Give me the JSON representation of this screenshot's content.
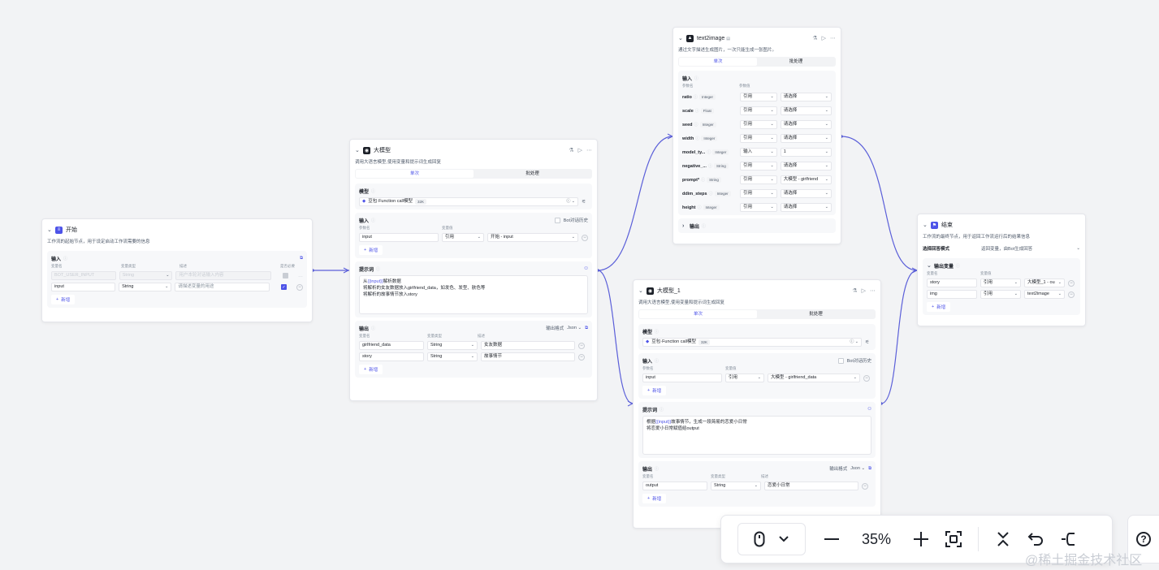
{
  "start": {
    "title": "开始",
    "desc": "工作流的起始节点，用于设定启动工作流需要的信息",
    "input_label": "输入",
    "col_name": "变量名",
    "col_type": "变量类型",
    "col_desc": "描述",
    "col_required": "是否必要",
    "rows": [
      {
        "name": "BOT_USER_INPUT",
        "type": "String",
        "desc": "用户本轮对话输入内容"
      },
      {
        "name": "input",
        "type": "String",
        "desc": "请描述变量的用途"
      }
    ],
    "add": "新增"
  },
  "llm": {
    "title": "大模型",
    "desc": "调用大语言模型,使用变量和提示词生成回复",
    "tab_single": "单次",
    "tab_batch": "批处理",
    "model_label": "模型",
    "model_name": "豆包·Function call模型",
    "model_ctx": "32K",
    "input_label": "输入",
    "bot_history": "Bot对话历史",
    "col_param": "参数名",
    "col_value": "变量值",
    "input_row": {
      "name": "input",
      "mode": "引用",
      "value": "开始 - input"
    },
    "add": "新增",
    "prompt_label": "提示词",
    "prompt_line1_var": "{{input}}",
    "prompt_line1_pre": "从",
    "prompt_line1_post": "解析数据",
    "prompt_line2": "将解析的女友数据放入girlfriend_data，如发色、发型、肤色等",
    "prompt_line3": "将解析的故事情节放入story",
    "output_label": "输出",
    "output_format_label": "输出格式",
    "output_format": "Json",
    "col_out_name": "变量名",
    "col_out_type": "变量类型",
    "col_out_desc": "描述",
    "outputs": [
      {
        "name": "girlfriend_data",
        "type": "String",
        "desc": "女友数据"
      },
      {
        "name": "story",
        "type": "String",
        "desc": "故事情节"
      }
    ]
  },
  "t2i": {
    "title": "text2image",
    "desc": "通过文字描述生成图片，一次只能生成一张图片。",
    "tab_single": "单次",
    "tab_batch": "批处理",
    "input_label": "输入",
    "col_param": "参数名",
    "col_value": "参数值",
    "params": [
      {
        "name": "ratio",
        "type": "Integer",
        "mode": "引用",
        "value": "请选择"
      },
      {
        "name": "scale",
        "type": "Float",
        "mode": "引用",
        "value": "请选择"
      },
      {
        "name": "seed",
        "type": "Integer",
        "mode": "引用",
        "value": "请选择"
      },
      {
        "name": "width",
        "type": "Integer",
        "mode": "引用",
        "value": "请选择"
      },
      {
        "name": "model_ty...",
        "type": "Integer",
        "mode": "输入",
        "value": "1"
      },
      {
        "name": "negative_...",
        "type": "String",
        "mode": "引用",
        "value": "请选择"
      },
      {
        "name": "prompt*",
        "type": "String",
        "mode": "引用",
        "value": "大模型 - girlfriend"
      },
      {
        "name": "ddim_steps",
        "type": "Integer",
        "mode": "引用",
        "value": "请选择"
      },
      {
        "name": "height",
        "type": "Integer",
        "mode": "引用",
        "value": "请选择"
      }
    ],
    "output_label": "输出"
  },
  "llm1": {
    "title": "大模型_1",
    "desc": "调用大语言模型,使用变量和提示词生成回复",
    "tab_single": "单次",
    "tab_batch": "批处理",
    "model_label": "模型",
    "model_name": "豆包·Function call模型",
    "model_ctx": "32K",
    "input_label": "输入",
    "bot_history": "Bot对话历史",
    "col_param": "参数名",
    "col_value": "变量值",
    "input_row": {
      "name": "input",
      "mode": "引用",
      "value": "大模型 - girlfriend_data"
    },
    "add": "新增",
    "prompt_label": "提示词",
    "prompt_line1_pre": "根据",
    "prompt_line1_var": "{{input}}",
    "prompt_line1_post": "故事情节，生成一段简易的恋爱小日常",
    "prompt_line2": "将恋爱小日常赋值给output",
    "output_label": "输出",
    "output_format_label": "输出格式",
    "output_format": "Json",
    "col_out_name": "变量名",
    "col_out_type": "变量类型",
    "col_out_desc": "描述",
    "outputs": [
      {
        "name": "output",
        "type": "String",
        "desc": "恋爱小日常"
      }
    ]
  },
  "end": {
    "title": "结束",
    "desc": "工作流的最终节点，用于返回工作流运行后的结果信息",
    "mode_label": "选择回答模式",
    "mode_value": "返回变量，由Bot生成回答",
    "output_label": "输出变量",
    "col_name": "变量名",
    "col_value": "变量值",
    "rows": [
      {
        "name": "story",
        "mode": "引用",
        "value": "大模型_1 - ou"
      },
      {
        "name": "img",
        "mode": "引用",
        "value": "text2image"
      }
    ],
    "add": "新增"
  },
  "toolbar": {
    "zoom": "35%"
  },
  "watermark": "@稀土掘金技术社区",
  "colors": {
    "accent": "#4d53e8",
    "edge": "#5b5fd9"
  }
}
